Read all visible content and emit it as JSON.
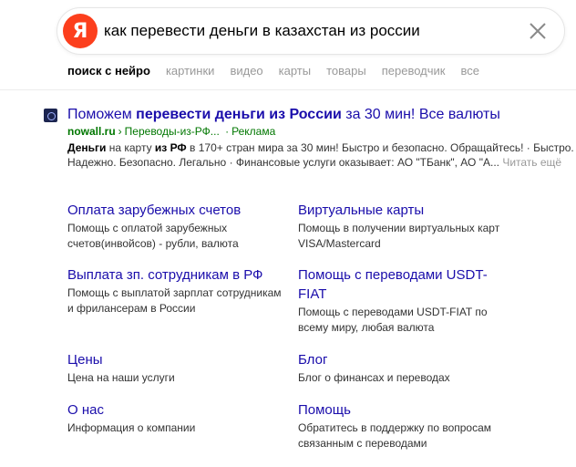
{
  "search": {
    "logo_letter": "Я",
    "query": "как перевести деньги в казахстан из россии"
  },
  "tabs": [
    {
      "label": "поиск с нейро",
      "active": true
    },
    {
      "label": "картинки"
    },
    {
      "label": "видео"
    },
    {
      "label": "карты"
    },
    {
      "label": "товары"
    },
    {
      "label": "переводчик"
    },
    {
      "label": "все"
    }
  ],
  "ad": {
    "title_plain_1": "Поможем ",
    "title_bold": "перевести деньги из России",
    "title_plain_2": " за 30 мин! Все валюты",
    "domain": "nowall.ru",
    "path": "Переводы-из-РФ...",
    "ad_label": "Реклама",
    "desc_bold_1": "Деньги",
    "desc_1": " на карту ",
    "desc_bold_2": "из РФ",
    "desc_2": " в 170+ стран мира за 30 мин! Быстро и безопасно. Обращайтесь! · Быстро. Надежно. Безопасно. Легально · Финансовые услуги оказывает: АО \"ТБанк\", АО \"А...",
    "read_more": "Читать ещё"
  },
  "sitelinks": [
    {
      "title": "Оплата зарубежных счетов",
      "desc": "Помощь с оплатой зарубежных счетов(инвойсов) - рубли, валюта"
    },
    {
      "title": "Виртуальные карты",
      "desc": "Помощь в получении виртуальных карт VISA/Mastercard"
    },
    {
      "title": "Выплата зп. сотрудникам в РФ",
      "desc": "Помощь с выплатой зарплат сотрудникам и фрилансерам в России"
    },
    {
      "title": "Помощь с переводами USDT-FIAT",
      "desc": "Помощь с переводами USDT-FIAT по всему миру, любая валюта"
    },
    {
      "title": "Цены",
      "desc": "Цена на наши услуги"
    },
    {
      "title": "Блог",
      "desc": "Блог о финансах и переводах"
    },
    {
      "title": "О нас",
      "desc": "Информация о компании"
    },
    {
      "title": "Помощь",
      "desc": "Обратитесь в поддержку по вопросам связанным с переводами"
    }
  ]
}
